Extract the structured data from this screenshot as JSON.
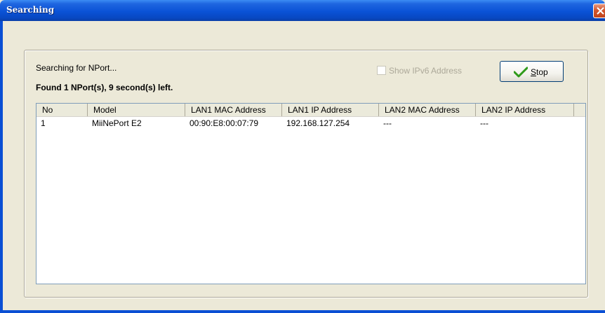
{
  "window": {
    "title": "Searching"
  },
  "search": {
    "status_text": "Searching for NPort...",
    "found_text": "Found 1 NPort(s), 9 second(s) left.",
    "ipv6_label": "Show IPv6 Address",
    "ipv6_checked": false,
    "stop_label": "Stop"
  },
  "table": {
    "columns": [
      "No",
      "Model",
      "LAN1 MAC Address",
      "LAN1 IP Address",
      "LAN2 MAC Address",
      "LAN2 IP Address"
    ],
    "rows": [
      [
        "1",
        "MiiNePort E2",
        "00:90:E8:00:07:79",
        "192.168.127.254",
        "---",
        "---"
      ]
    ]
  },
  "icons": {
    "close": "close-icon",
    "stop": "checkmark-icon"
  },
  "colors": {
    "title_bar": "#0a52d6",
    "check": "#2f9a1a"
  }
}
